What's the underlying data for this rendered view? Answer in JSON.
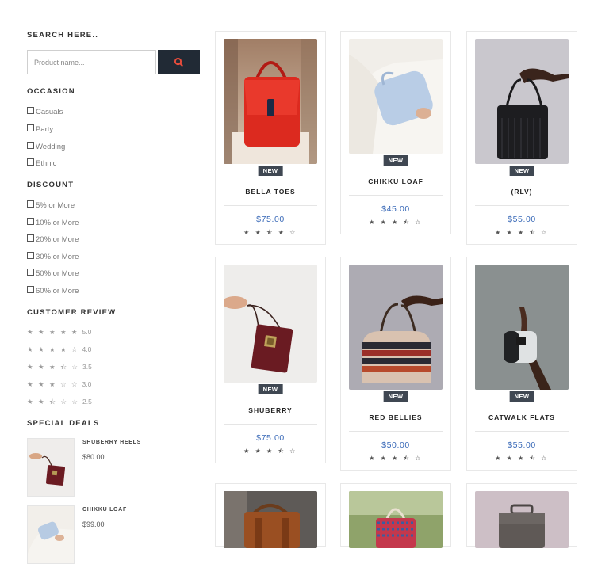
{
  "search": {
    "title": "SEARCH HERE..",
    "placeholder": "Product name...",
    "button_icon": "search-icon"
  },
  "occasion": {
    "title": "OCCASION",
    "items": [
      "Casuals",
      "Party",
      "Wedding",
      "Ethnic"
    ]
  },
  "discount": {
    "title": "DISCOUNT",
    "items": [
      "5% or More",
      "10% or More",
      "20% or More",
      "30% or More",
      "50% or More",
      "60% or More"
    ]
  },
  "review": {
    "title": "CUSTOMER REVIEW",
    "items": [
      {
        "stars": "★ ★ ★ ★ ★",
        "value": "5.0"
      },
      {
        "stars": "★ ★ ★ ★ ☆",
        "value": "4.0"
      },
      {
        "stars": "★ ★ ★ ⯪ ☆",
        "value": "3.5"
      },
      {
        "stars": "★ ★ ★ ☆ ☆",
        "value": "3.0"
      },
      {
        "stars": "★ ★ ⯪ ☆ ☆",
        "value": "2.5"
      }
    ]
  },
  "deals": {
    "title": "SPECIAL DEALS",
    "items": [
      {
        "name": "SHUBERRY HEELS",
        "price": "$80.00"
      },
      {
        "name": "CHIKKU LOAF",
        "price": "$99.00"
      }
    ]
  },
  "products": [
    {
      "name": "BELLA TOES",
      "badge": "NEW",
      "price": "$75.00",
      "stars": "★ ★ ⯪ ★ ☆",
      "rating": 3.5
    },
    {
      "name": "CHIKKU LOAF",
      "badge": "NEW",
      "price": "$45.00",
      "stars": "★ ★ ★ ⯪ ☆",
      "rating": 3.5
    },
    {
      "name": "(RLV)",
      "badge": "NEW",
      "price": "$55.00",
      "stars": "★ ★ ★ ⯪ ☆",
      "rating": 3.5
    },
    {
      "name": "SHUBERRY",
      "badge": "NEW",
      "price": "$75.00",
      "stars": "★ ★ ★ ⯪ ☆",
      "rating": 3.5
    },
    {
      "name": "RED BELLIES",
      "badge": "NEW",
      "price": "$50.00",
      "stars": "★ ★ ★ ⯪ ☆",
      "rating": 3.5
    },
    {
      "name": "CATWALK FLATS",
      "badge": "NEW",
      "price": "$55.00",
      "stars": "★ ★ ★ ⯪ ☆",
      "rating": 3.5
    }
  ],
  "colors": {
    "accent_dark": "#212a35",
    "search_icon": "#e74c3c",
    "price_blue": "#3a6ab8",
    "badge": "#3f4752"
  }
}
